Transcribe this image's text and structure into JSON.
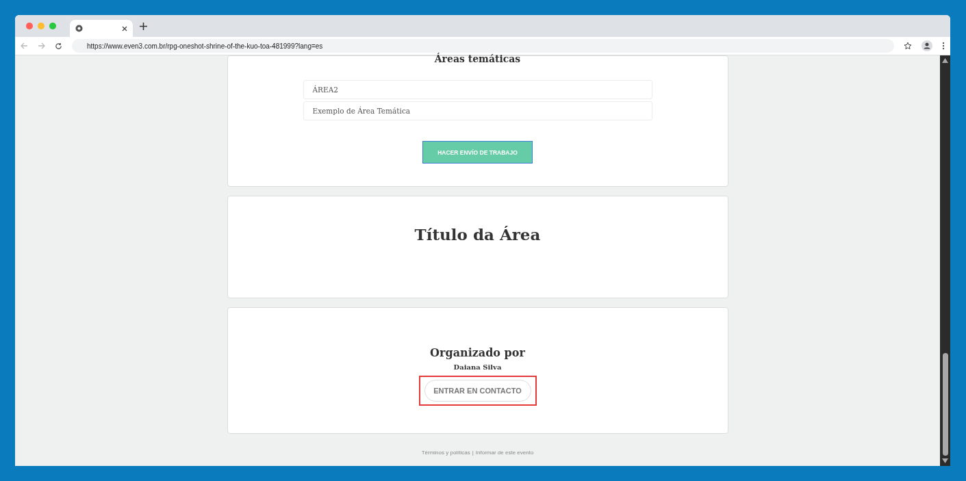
{
  "browser": {
    "url": "https://www.even3.com.br/rpg-oneshot-shrine-of-the-kuo-toa-481999?lang=es"
  },
  "areas_card": {
    "title": "Áreas temáticas",
    "items": [
      "ÁREA2",
      "Exemplo de Área Temática"
    ],
    "submit_button": "HACER ENVÍO DE TRABAJO"
  },
  "area_title_card": {
    "title": "Título da Área"
  },
  "organizer_card": {
    "title": "Organizado por",
    "name": "Daiana Silva",
    "contact_button": "ENTRAR EN CONTACTO",
    "highlighted": true
  },
  "footer": {
    "links": [
      "Términos y políticas",
      "Informar de este evento"
    ],
    "separator": "|"
  }
}
